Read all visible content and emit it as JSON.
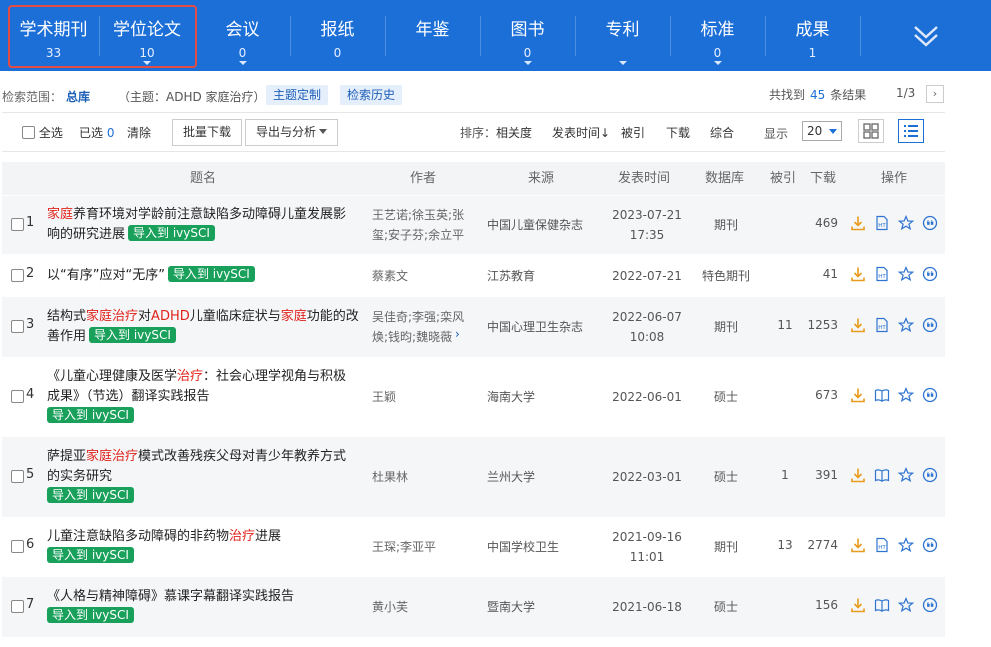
{
  "categories": [
    {
      "name": "学术期刊",
      "count": "33",
      "caret": false
    },
    {
      "name": "学位论文",
      "count": "10",
      "caret": true
    },
    {
      "name": "会议",
      "count": "0",
      "caret": true
    },
    {
      "name": "报纸",
      "count": "0",
      "caret": false
    },
    {
      "name": "年鉴",
      "count": "",
      "caret": false
    },
    {
      "name": "图书",
      "count": "0",
      "caret": true
    },
    {
      "name": "专利",
      "count": "",
      "caret": true
    },
    {
      "name": "标准",
      "count": "0",
      "caret": true
    },
    {
      "name": "成果",
      "count": "1",
      "caret": false
    }
  ],
  "scope": {
    "label": "检索范围：",
    "value": "总库",
    "topic": "（主题：ADHD 家庭治疗）",
    "custom_btn": "主题定制",
    "history_btn": "检索历史",
    "found_prefix": "共找到",
    "found_count": "45",
    "found_suffix": "条结果",
    "page": "1/3",
    "next_glyph": "›"
  },
  "toolbar": {
    "select_all": "全选",
    "selected_label": "已选",
    "selected_count": "0",
    "clear": "清除",
    "batch_download": "批量下载",
    "export": "导出与分析",
    "sort_label": "排序：",
    "sort_relevance": "相关度",
    "sort_date": "发表时间",
    "sort_date_arrow": "↓",
    "sort_cite": "被引",
    "sort_download": "下载",
    "sort_composite": "综合",
    "show_label": "显示",
    "page_size": "20"
  },
  "table": {
    "headers": {
      "title": "题名",
      "author": "作者",
      "source": "来源",
      "date": "发表时间",
      "db": "数据库",
      "cite": "被引",
      "download": "下载",
      "ops": "操作"
    },
    "ivy_label": "导入到 ivySCI",
    "more_glyph": "›",
    "rows": [
      {
        "no": "1",
        "title_parts": [
          {
            "t": "家庭",
            "kw": true
          },
          {
            "t": "养育环境对学龄前注意缺陷多动障碍儿童发展影响的研究进展",
            "kw": false
          }
        ],
        "authors": "王艺诺;徐玉英;张玺;安子芬;余立平",
        "source": "中国儿童保健杂志",
        "date": "2023-07-21",
        "time": "17:35",
        "db": "期刊",
        "cite": "",
        "download": "469",
        "more": false
      },
      {
        "no": "2",
        "title_parts": [
          {
            "t": "以“有序”应对“无序”",
            "kw": false
          }
        ],
        "authors": "蔡素文",
        "source": "江苏教育",
        "date": "2022-07-21",
        "time": "",
        "db": "特色期刊",
        "cite": "",
        "download": "41",
        "more": false
      },
      {
        "no": "3",
        "title_parts": [
          {
            "t": "结构式",
            "kw": false
          },
          {
            "t": "家庭治疗",
            "kw": true
          },
          {
            "t": "对",
            "kw": false
          },
          {
            "t": "ADHD",
            "kw": true
          },
          {
            "t": "儿童临床症状与",
            "kw": false
          },
          {
            "t": "家庭",
            "kw": true
          },
          {
            "t": "功能的改善作用",
            "kw": false
          }
        ],
        "authors": "吴佳奇;李强;栾风焕;钱昀;魏晓薇",
        "source": "中国心理卫生杂志",
        "date": "2022-06-07",
        "time": "10:08",
        "db": "期刊",
        "cite": "11",
        "download": "1253",
        "more": true
      },
      {
        "no": "4",
        "title_parts": [
          {
            "t": "《儿童心理健康及医学",
            "kw": false
          },
          {
            "t": "治疗",
            "kw": true
          },
          {
            "t": "：社会心理学视角与积极成果》（节选）翻译实践报告",
            "kw": false
          }
        ],
        "authors": "王颖",
        "source": "海南大学",
        "date": "2022-06-01",
        "time": "",
        "db": "硕士",
        "cite": "",
        "download": "673",
        "more": false
      },
      {
        "no": "5",
        "title_parts": [
          {
            "t": "萨提亚",
            "kw": false
          },
          {
            "t": "家庭治疗",
            "kw": true
          },
          {
            "t": "模式改善残疾父母对青少年教养方式的实务研究",
            "kw": false
          }
        ],
        "authors": "杜果林",
        "source": "兰州大学",
        "date": "2022-03-01",
        "time": "",
        "db": "硕士",
        "cite": "1",
        "download": "391",
        "more": false
      },
      {
        "no": "6",
        "title_parts": [
          {
            "t": "儿童注意缺陷多动障碍的非药物",
            "kw": false
          },
          {
            "t": "治疗",
            "kw": true
          },
          {
            "t": "进展",
            "kw": false
          }
        ],
        "authors": "王琛;李亚平",
        "source": "中国学校卫生",
        "date": "2021-09-16",
        "time": "11:01",
        "db": "期刊",
        "cite": "13",
        "download": "2774",
        "more": false
      },
      {
        "no": "7",
        "title_parts": [
          {
            "t": "《人格与精神障碍》慕课字幕翻译实践报告",
            "kw": false
          }
        ],
        "authors": "黄小芙",
        "source": "暨南大学",
        "date": "2021-06-18",
        "time": "",
        "db": "硕士",
        "cite": "",
        "download": "156",
        "more": false
      }
    ]
  },
  "colors": {
    "brand_blue": "#1d6fd8",
    "keyword_red": "#e0231b",
    "ivy_green": "#19a15b",
    "highlight_box": "#e34b45",
    "download_orange": "#e89b1c"
  }
}
